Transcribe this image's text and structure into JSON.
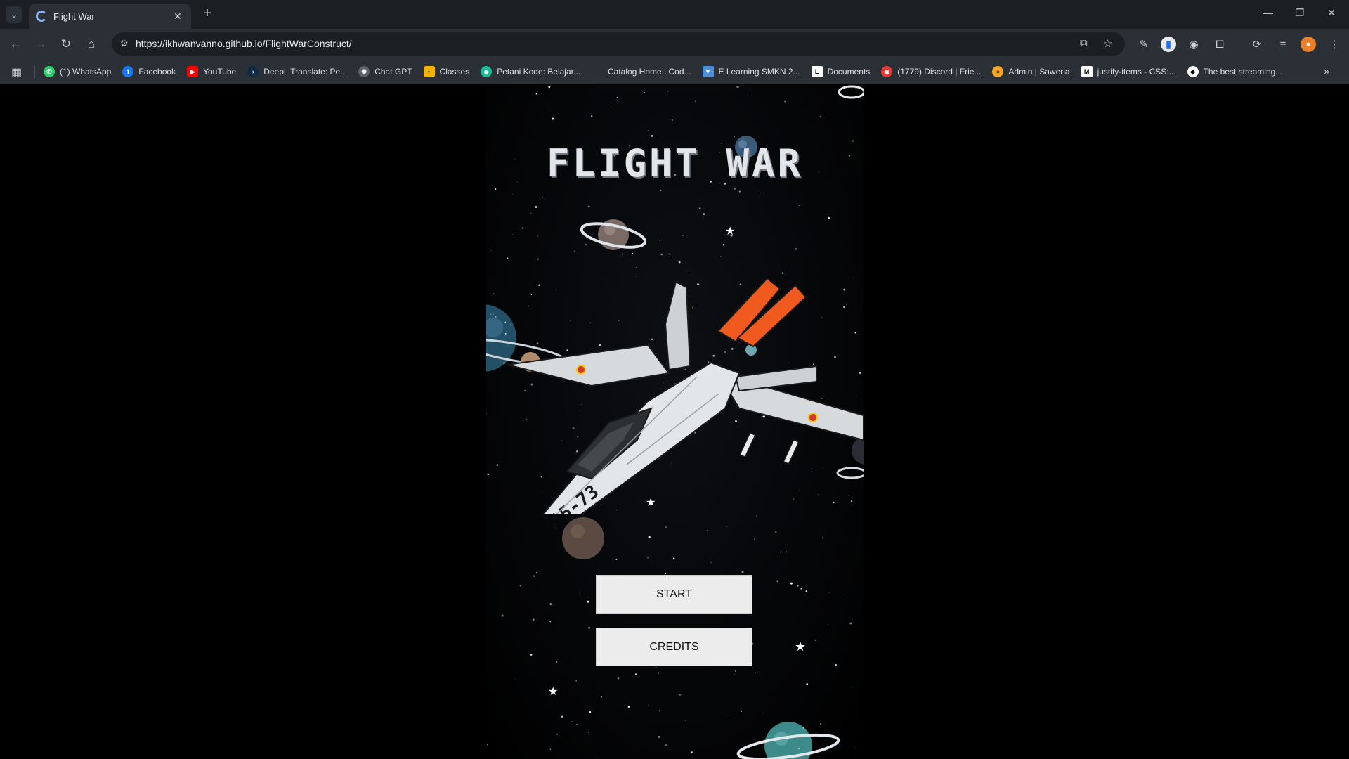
{
  "browser": {
    "tab_title": "Flight War",
    "url": "https://ikhwanvanno.github.io/FlightWarConstruct/",
    "bookmarks": [
      {
        "label": "(1) WhatsApp",
        "icon": "whatsapp-icon",
        "color": "#25d366"
      },
      {
        "label": "Facebook",
        "icon": "facebook-icon",
        "color": "#1877f2"
      },
      {
        "label": "YouTube",
        "icon": "youtube-icon",
        "color": "#ff0000"
      },
      {
        "label": "DeepL Translate: Pe...",
        "icon": "deepl-icon",
        "color": "#0f2b46"
      },
      {
        "label": "Chat GPT",
        "icon": "chatgpt-icon",
        "color": "#9aa0a6"
      },
      {
        "label": "Classes",
        "icon": "classroom-icon",
        "color": "#f4b400"
      },
      {
        "label": "Petani Kode: Belajar...",
        "icon": "petanikode-icon",
        "color": "#1abc9c"
      },
      {
        "label": "Catalog Home | Cod...",
        "icon": "codecademy-icon",
        "color": "#2a3036"
      },
      {
        "label": "E Learning SMKN 2...",
        "icon": "elearning-icon",
        "color": "#4a90d9"
      },
      {
        "label": "Documents",
        "icon": "documents-icon",
        "color": "#ffffff"
      },
      {
        "label": "(1779) Discord | Frie...",
        "icon": "discord-icon",
        "color": "#e53935"
      },
      {
        "label": "Admin | Saweria",
        "icon": "saweria-icon",
        "color": "#f5a623"
      },
      {
        "label": "justify-items - CSS:...",
        "icon": "mdn-icon",
        "color": "#ffffff"
      },
      {
        "label": "The best streaming...",
        "icon": "streaming-icon",
        "color": "#ffffff"
      }
    ]
  },
  "game": {
    "title": "FLIGHT WAR",
    "start_label": "START",
    "credits_label": "CREDITS"
  }
}
